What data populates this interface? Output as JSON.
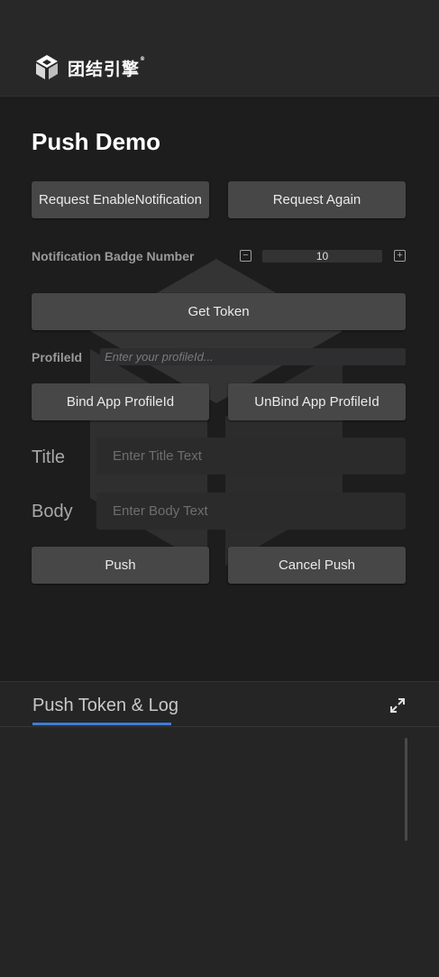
{
  "header": {
    "logo_text": "团结引擎",
    "logo_mark": "®"
  },
  "page": {
    "title": "Push Demo"
  },
  "buttons": {
    "request_enable": "Request EnableNotification",
    "request_again": "Request Again",
    "get_token": "Get Token",
    "bind": "Bind App ProfileId",
    "unbind": "UnBind App ProfileId",
    "push": "Push",
    "cancel_push": "Cancel Push"
  },
  "badge": {
    "label": "Notification Badge Number",
    "value": "10",
    "minus": "−",
    "plus": "+"
  },
  "profile": {
    "label": "ProfileId",
    "placeholder": "Enter your profileId..."
  },
  "title_field": {
    "label": "Title",
    "placeholder": "Enter Title Text"
  },
  "body_field": {
    "label": "Body",
    "placeholder": "Enter Body Text"
  },
  "log_panel": {
    "tab_label": "Push Token & Log"
  },
  "colors": {
    "accent": "#3d7cd6",
    "button": "#474747",
    "background": "#1d1d1d"
  }
}
